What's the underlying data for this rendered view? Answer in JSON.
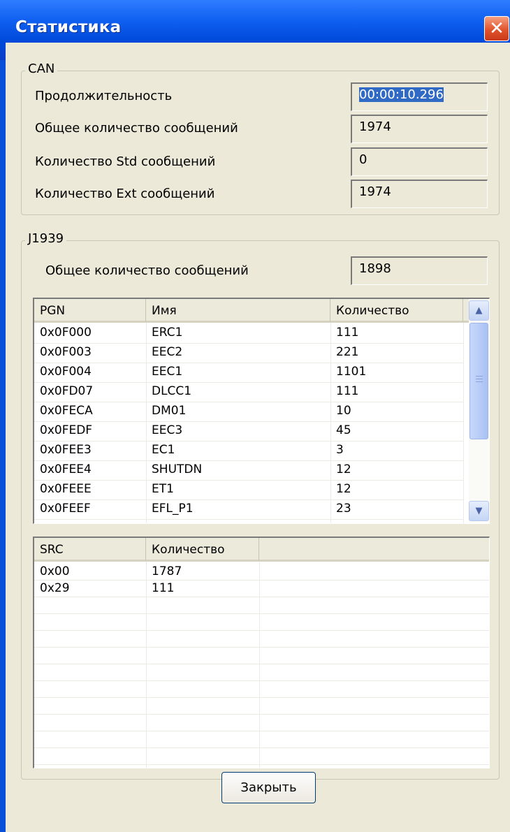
{
  "window": {
    "title": "Статистика"
  },
  "can": {
    "legend": "CAN",
    "rows": [
      {
        "label": "Продолжительность",
        "value": "00:00:10.296"
      },
      {
        "label": "Общее количество сообщений",
        "value": "1974"
      },
      {
        "label": "Количество Std сообщений",
        "value": "0"
      },
      {
        "label": "Количество Ext сообщений",
        "value": "1974"
      }
    ]
  },
  "j1939": {
    "legend": "J1939",
    "total_label": "Общее количество сообщений",
    "total_value": "1898",
    "pgn_table": {
      "headers": [
        "PGN",
        "Имя",
        "Количество"
      ],
      "rows": [
        [
          "0x0F000",
          "ERC1",
          "111"
        ],
        [
          "0x0F003",
          "EEC2",
          "221"
        ],
        [
          "0x0F004",
          "EEC1",
          "1101"
        ],
        [
          "0x0FD07",
          "DLCC1",
          "111"
        ],
        [
          "0x0FECA",
          "DM01",
          "10"
        ],
        [
          "0x0FEDF",
          "EEC3",
          "45"
        ],
        [
          "0x0FEE3",
          "EC1",
          "3"
        ],
        [
          "0x0FEE4",
          "SHUTDN",
          "12"
        ],
        [
          "0x0FEEE",
          "ET1",
          "12"
        ],
        [
          "0x0FEEF",
          "EFL_P1",
          "23"
        ]
      ]
    },
    "src_table": {
      "headers": [
        "SRC",
        "Количество"
      ],
      "rows": [
        [
          "0x00",
          "1787"
        ],
        [
          "0x29",
          "111"
        ]
      ]
    }
  },
  "buttons": {
    "close_label": "Закрыть"
  },
  "icons": {
    "close": "close-icon",
    "scroll_up": "scroll-up-arrow-icon",
    "scroll_down": "scroll-down-arrow-icon"
  },
  "colors": {
    "titlebar": "#0a4fd8",
    "dialog_bg": "#ece9d8",
    "selection": "#316ac5",
    "close_button": "#e0542c"
  }
}
